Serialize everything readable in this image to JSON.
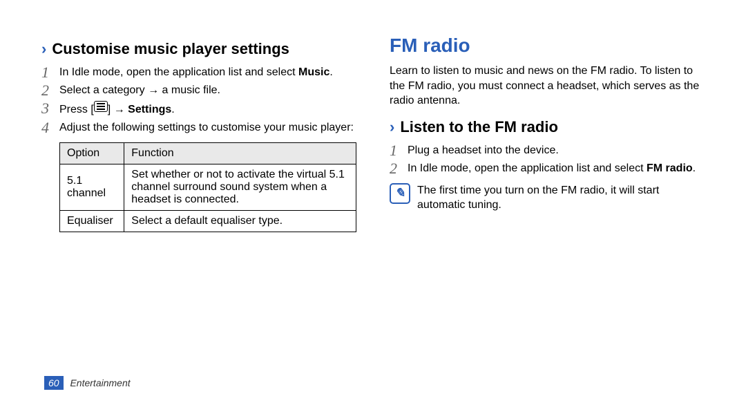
{
  "left": {
    "heading": "Customise music player settings",
    "steps": [
      {
        "num": "1",
        "pre": "In Idle mode, open the application list and select ",
        "bold": "Music",
        "post": "."
      },
      {
        "num": "2",
        "pre": "Select a category → a music file.",
        "bold": "",
        "post": ""
      },
      {
        "num": "3",
        "pre": "Press ",
        "key": true,
        "mid": " → ",
        "bold": "Settings",
        "post": "."
      },
      {
        "num": "4",
        "pre": "Adjust the following settings to customise your music player:",
        "bold": "",
        "post": ""
      }
    ],
    "table": {
      "headers": [
        "Option",
        "Function"
      ],
      "rows": [
        [
          "5.1 channel",
          "Set whether or not to activate the virtual 5.1 channel surround sound system when a headset is connected."
        ],
        [
          "Equaliser",
          "Select a default equaliser type."
        ]
      ]
    }
  },
  "right": {
    "title": "FM radio",
    "intro": "Learn to listen to music and news on the FM radio. To listen to the FM radio, you must connect a headset, which serves as the radio antenna.",
    "heading": "Listen to the FM radio",
    "steps": [
      {
        "num": "1",
        "pre": "Plug a headset into the device.",
        "bold": "",
        "post": ""
      },
      {
        "num": "2",
        "pre": "In Idle mode, open the application list and select ",
        "bold": "FM radio",
        "post": "."
      }
    ],
    "note": "The first time you turn on the FM radio, it will start automatic tuning.",
    "note_icon_glyph": "✎"
  },
  "footer": {
    "page": "60",
    "chapter": "Entertainment"
  }
}
